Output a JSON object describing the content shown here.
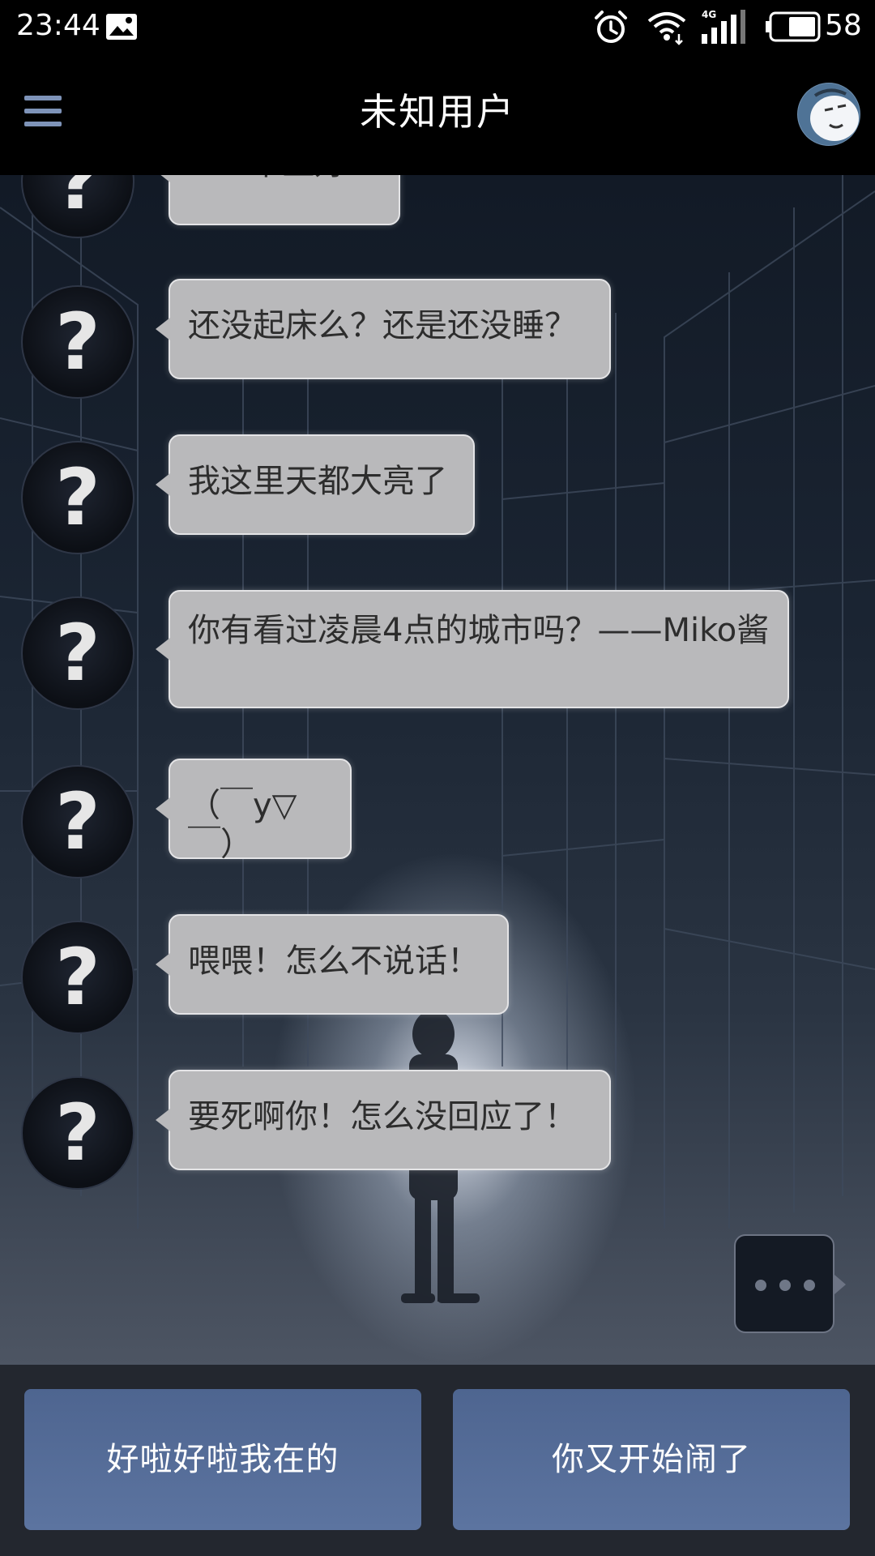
{
  "status_bar": {
    "time": "23:44",
    "battery_level": "58",
    "icons": [
      "gallery-icon",
      "alarm-icon",
      "wifi-icon",
      "signal-4g-icon",
      "battery-icon"
    ]
  },
  "header": {
    "title": "未知用户",
    "menu_icon": "menu-icon",
    "avatar": "user-avatar"
  },
  "chat": {
    "sender_avatar_symbol": "?",
    "messages": [
      {
        "text": "hi！早上好！"
      },
      {
        "text": "还没起床么？还是还没睡？"
      },
      {
        "text": "我这里天都大亮了"
      },
      {
        "text": "你有看过凌晨4点的城市吗？——Miko酱"
      },
      {
        "text": "（￣y▽￣）"
      },
      {
        "text": "喂喂！怎么不说话！"
      },
      {
        "text": "要死啊你！怎么没回应了！"
      }
    ],
    "typing_indicator": "typing-dots-icon"
  },
  "reply_options": [
    {
      "label": "好啦好啦我在的"
    },
    {
      "label": "你又开始闹了"
    }
  ],
  "colors": {
    "bubble": "#b9b9bb",
    "reply_button": "#5a70a0",
    "bar": "#000000"
  }
}
